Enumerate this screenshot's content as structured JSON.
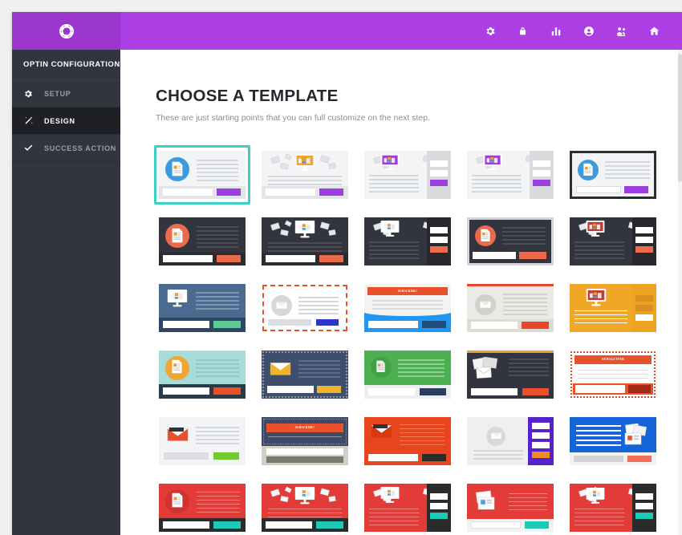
{
  "header": {
    "brand_color": "#ab3fe4",
    "logo_icon": "abstract-knot-logo",
    "icons": [
      {
        "name": "gear-icon",
        "label": "Settings"
      },
      {
        "name": "lock-icon",
        "label": "Security"
      },
      {
        "name": "bar-chart-icon",
        "label": "Statistics"
      },
      {
        "name": "user-circle-icon",
        "label": "Account"
      },
      {
        "name": "users-icon",
        "label": "Subscribers"
      },
      {
        "name": "home-icon",
        "label": "Home"
      }
    ]
  },
  "sidebar": {
    "title": "OPTIN CONFIGURATION",
    "items": [
      {
        "label": "SETUP",
        "icon": "gear-icon",
        "active": false
      },
      {
        "label": "DESIGN",
        "icon": "wand-icon",
        "active": true
      },
      {
        "label": "SUCCESS ACTION",
        "icon": "check-icon",
        "active": false
      }
    ]
  },
  "main": {
    "title": "CHOOSE A TEMPLATE",
    "subtitle": "These are just starting points that you can full customize on the next step.",
    "selected_border_color": "#3ed0c2"
  },
  "templates": [
    {
      "id": "t1",
      "row": 1,
      "col": 1,
      "style": "light-circle-icon",
      "accent": "#9b3fe0",
      "bg": "#f3f4f5",
      "selected": true,
      "ribbon": null
    },
    {
      "id": "t2",
      "row": 1,
      "col": 2,
      "style": "light-monitor-center",
      "accent": "#9b3fe0",
      "bg": "#f3f4f5",
      "selected": false,
      "ribbon": null
    },
    {
      "id": "t3",
      "row": 1,
      "col": 3,
      "style": "light-monitor-side",
      "accent": "#9b3fe0",
      "bg": "#f3f4f5",
      "selected": false,
      "ribbon": null
    },
    {
      "id": "t4",
      "row": 1,
      "col": 4,
      "style": "light-monitor-sidebar",
      "accent": "#9b3fe0",
      "bg": "#f3f4f5",
      "selected": false,
      "ribbon": null
    },
    {
      "id": "t5",
      "row": 1,
      "col": 5,
      "style": "dark-border-circle",
      "accent": "#9b3fe0",
      "bg": "#f3f4f5",
      "selected": false,
      "ribbon": null
    },
    {
      "id": "t6",
      "row": 2,
      "col": 1,
      "style": "dark-circle-icon",
      "accent": "#ec6a4c",
      "bg": "#32353d",
      "selected": false,
      "ribbon": null
    },
    {
      "id": "t7",
      "row": 2,
      "col": 2,
      "style": "dark-monitor-center",
      "accent": "#ec6a4c",
      "bg": "#32353d",
      "selected": false,
      "ribbon": null
    },
    {
      "id": "t8",
      "row": 2,
      "col": 3,
      "style": "dark-monitor-side",
      "accent": "#ec6a4c",
      "bg": "#32353d",
      "selected": false,
      "ribbon": null
    },
    {
      "id": "t9",
      "row": 2,
      "col": 4,
      "style": "dark-framed-circle",
      "accent": "#ec6a4c",
      "bg": "#32353d",
      "selected": false,
      "ribbon": null
    },
    {
      "id": "t10",
      "row": 2,
      "col": 5,
      "style": "dark-monitor-sidebar",
      "accent": "#ec6a4c",
      "bg": "#32353d",
      "selected": false,
      "ribbon": null
    },
    {
      "id": "t11",
      "row": 3,
      "col": 1,
      "style": "blue-monitor",
      "accent": "#5fc99a",
      "bg": "#4a6a8f",
      "selected": false,
      "ribbon": null
    },
    {
      "id": "t12",
      "row": 3,
      "col": 2,
      "style": "dashed-envelope",
      "accent": "#2a36c9",
      "bg": "#ffffff",
      "selected": false,
      "ribbon": null
    },
    {
      "id": "t13",
      "row": 3,
      "col": 3,
      "style": "blue-ribbon",
      "accent": "#1c4f80",
      "bg": "#2196f3",
      "selected": false,
      "ribbon": "SUBSCRIBE!"
    },
    {
      "id": "t14",
      "row": 3,
      "col": 4,
      "style": "gray-envelope-stamp",
      "accent": "#e8462a",
      "bg": "#eceae6",
      "selected": false,
      "ribbon": null
    },
    {
      "id": "t15",
      "row": 3,
      "col": 5,
      "style": "orange-monitor",
      "accent": "#ffffff",
      "bg": "#f0a728",
      "selected": false,
      "ribbon": null
    },
    {
      "id": "t16",
      "row": 4,
      "col": 1,
      "style": "teal-circle",
      "accent": "#ec5026",
      "bg": "#a8dcd9",
      "selected": false,
      "ribbon": null
    },
    {
      "id": "t17",
      "row": 4,
      "col": 2,
      "style": "navy-envelope",
      "accent": "#f0b429",
      "bg": "#3f4e6b",
      "selected": false,
      "ribbon": null
    },
    {
      "id": "t18",
      "row": 4,
      "col": 3,
      "style": "green-circle",
      "accent": "#2c3e60",
      "bg": "#4caf50",
      "selected": false,
      "ribbon": null
    },
    {
      "id": "t19",
      "row": 4,
      "col": 4,
      "style": "dark-letters",
      "accent": "#e8512c",
      "bg": "#32353d",
      "selected": false,
      "ribbon": null
    },
    {
      "id": "t20",
      "row": 4,
      "col": 5,
      "style": "newsletter-ribbon",
      "accent": "#9e2b15",
      "bg": "#ffffff",
      "selected": false,
      "ribbon": "NEWSLETTER"
    },
    {
      "id": "t21",
      "row": 5,
      "col": 1,
      "style": "light-envelope",
      "accent": "#6fcc2a",
      "bg": "#f3f4f5",
      "selected": false,
      "ribbon": null
    },
    {
      "id": "t22",
      "row": 5,
      "col": 2,
      "style": "navy-ribbon",
      "accent": "#7c7a6e",
      "bg": "#3d4a66",
      "selected": false,
      "ribbon": "SUBSCRIBE!"
    },
    {
      "id": "t23",
      "row": 5,
      "col": 3,
      "style": "red-envelope",
      "accent": "#2b2b2b",
      "bg": "#e8451f",
      "selected": false,
      "ribbon": null
    },
    {
      "id": "t24",
      "row": 5,
      "col": 4,
      "style": "purple-sidebar",
      "accent": "#f08a28",
      "bg": "#efefef",
      "selected": false,
      "ribbon": null
    },
    {
      "id": "t25",
      "row": 5,
      "col": 5,
      "style": "blue-letters",
      "accent": "#f2705a",
      "bg": "#1565d8",
      "selected": false,
      "ribbon": null
    },
    {
      "id": "t26",
      "row": 6,
      "col": 1,
      "style": "red-circle-icon",
      "accent": "#1ec9b7",
      "bg": "#e33b38",
      "selected": false,
      "ribbon": null
    },
    {
      "id": "t27",
      "row": 6,
      "col": 2,
      "style": "red-monitor-center",
      "accent": "#1ec9b7",
      "bg": "#e33b38",
      "selected": false,
      "ribbon": null
    },
    {
      "id": "t28",
      "row": 6,
      "col": 3,
      "style": "red-monitor-side",
      "accent": "#1ec9b7",
      "bg": "#e33b38",
      "selected": false,
      "ribbon": null
    },
    {
      "id": "t29",
      "row": 6,
      "col": 4,
      "style": "red-monitor-sidebar",
      "accent": "#1ec9b7",
      "bg": "#e33b38",
      "selected": false,
      "ribbon": null
    },
    {
      "id": "t30",
      "row": 6,
      "col": 5,
      "style": "red-letters-panel",
      "accent": "#1ec9b7",
      "bg": "#e33b38",
      "selected": false,
      "ribbon": null
    }
  ]
}
